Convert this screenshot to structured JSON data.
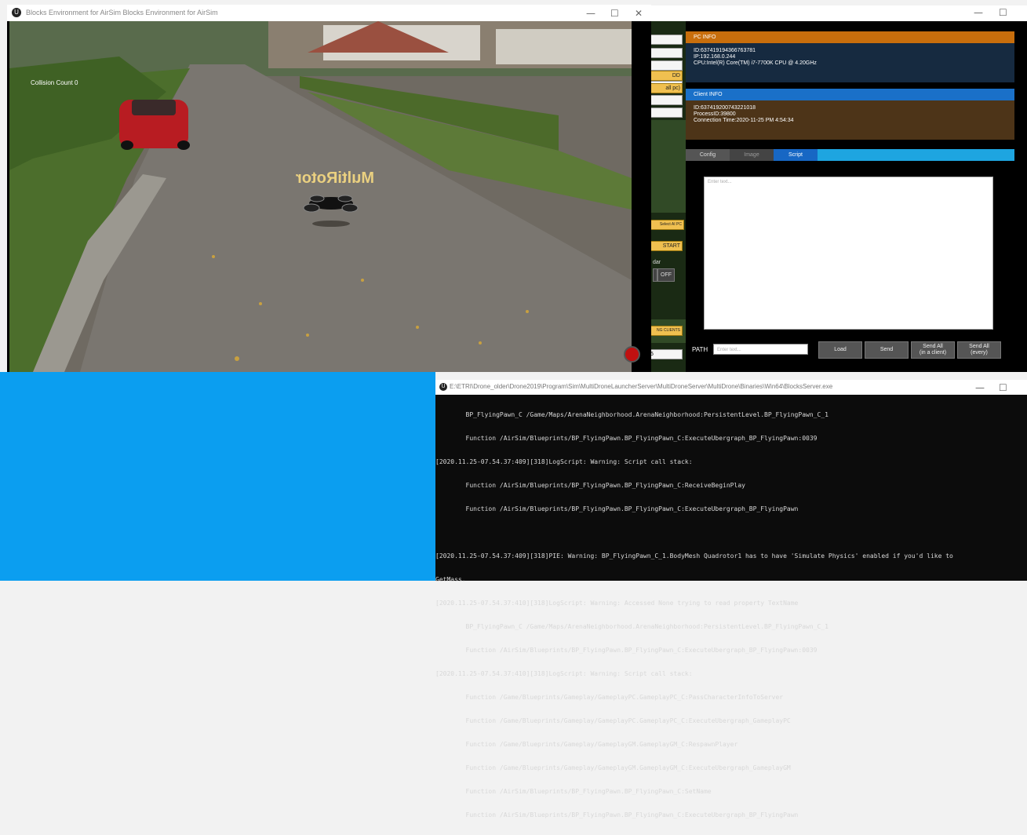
{
  "game_window": {
    "title": "Blocks Environment for AirSim Blocks Environment for AirSim",
    "collision_text": "Collision Count 0",
    "drone_label": "MultiRotor",
    "minimize": "—",
    "maximize": "☐",
    "close": "✕"
  },
  "app_window": {
    "minimize": "—",
    "maximize": "☐",
    "left_controls": {
      "add_label": "DD",
      "all_pc_label": "all pc)",
      "select_pc_label": "Select AI PC",
      "start_label": "START",
      "radar_label": "dar",
      "off_label": "OFF",
      "clients_label": "NG CLIENTS",
      "bottom_value": "5"
    },
    "pc_info": {
      "header": "PC INFO",
      "id": "ID:637419194366763781",
      "ip": "IP:192.168.0.244",
      "cpu": "CPU:Intel(R) Core(TM) i7-7700K CPU @ 4.20GHz"
    },
    "client_info": {
      "header": "Client INFO",
      "id": "ID:637419200743221018",
      "process": "ProcessID:39800",
      "connection": "Connection Time:2020-11-25 PM 4:54:34"
    },
    "tabs": [
      "Config",
      "Image",
      "Script"
    ],
    "script_placeholder": "Enter text...",
    "path_label": "PATH",
    "path_placeholder": "Enter text...",
    "buttons": {
      "load": "Load",
      "send": "Send",
      "send_all_client_1": "Send All",
      "send_all_client_2": "(in a client)",
      "send_all_every_1": "Send All",
      "send_all_every_2": "(every)"
    }
  },
  "console": {
    "title": "E:\\ETRI\\Drone_older\\Drone2019\\Program\\Sim\\MultiDroneLauncherServer\\MultiDroneServer\\MultiDrone\\Binaries\\Win64\\BlocksServer.exe",
    "lines": [
      "        BP_FlyingPawn_C /Game/Maps/ArenaNeighborhood.ArenaNeighborhood:PersistentLevel.BP_FlyingPawn_C_1",
      "        Function /AirSim/Blueprints/BP_FlyingPawn.BP_FlyingPawn_C:ExecuteUbergraph_BP_FlyingPawn:0039",
      "[2020.11.25-07.54.37:409][318]LogScript: Warning: Script call stack:",
      "        Function /AirSim/Blueprints/BP_FlyingPawn.BP_FlyingPawn_C:ReceiveBeginPlay",
      "        Function /AirSim/Blueprints/BP_FlyingPawn.BP_FlyingPawn_C:ExecuteUbergraph_BP_FlyingPawn",
      "",
      "[2020.11.25-07.54.37:409][318]PIE: Warning: BP_FlyingPawn_C_1.BodyMesh Quadrotor1 has to have 'Simulate Physics' enabled if you'd like to",
      "GetMass.",
      "[2020.11.25-07.54.37:410][318]LogScript: Warning: Accessed None trying to read property TextName",
      "        BP_FlyingPawn_C /Game/Maps/ArenaNeighborhood.ArenaNeighborhood:PersistentLevel.BP_FlyingPawn_C_1",
      "        Function /AirSim/Blueprints/BP_FlyingPawn.BP_FlyingPawn_C:ExecuteUbergraph_BP_FlyingPawn:0039",
      "[2020.11.25-07.54.37:410][318]LogScript: Warning: Script call stack:",
      "        Function /Game/Blueprints/Gameplay/GameplayPC.GameplayPC_C:PassCharacterInfoToServer",
      "        Function /Game/Blueprints/Gameplay/GameplayPC.GameplayPC_C:ExecuteUbergraph_GameplayPC",
      "        Function /Game/Blueprints/Gameplay/GameplayGM.GameplayGM_C:RespawnPlayer",
      "        Function /Game/Blueprints/Gameplay/GameplayGM.GameplayGM_C:ExecuteUbergraph_GameplayGM",
      "        Function /AirSim/Blueprints/BP_FlyingPawn.BP_FlyingPawn_C:SetName",
      "        Function /AirSim/Blueprints/BP_FlyingPawn.BP_FlyingPawn_C:ExecuteUbergraph_BP_FlyingPawn"
    ],
    "minimize": "—",
    "maximize": "☐"
  }
}
